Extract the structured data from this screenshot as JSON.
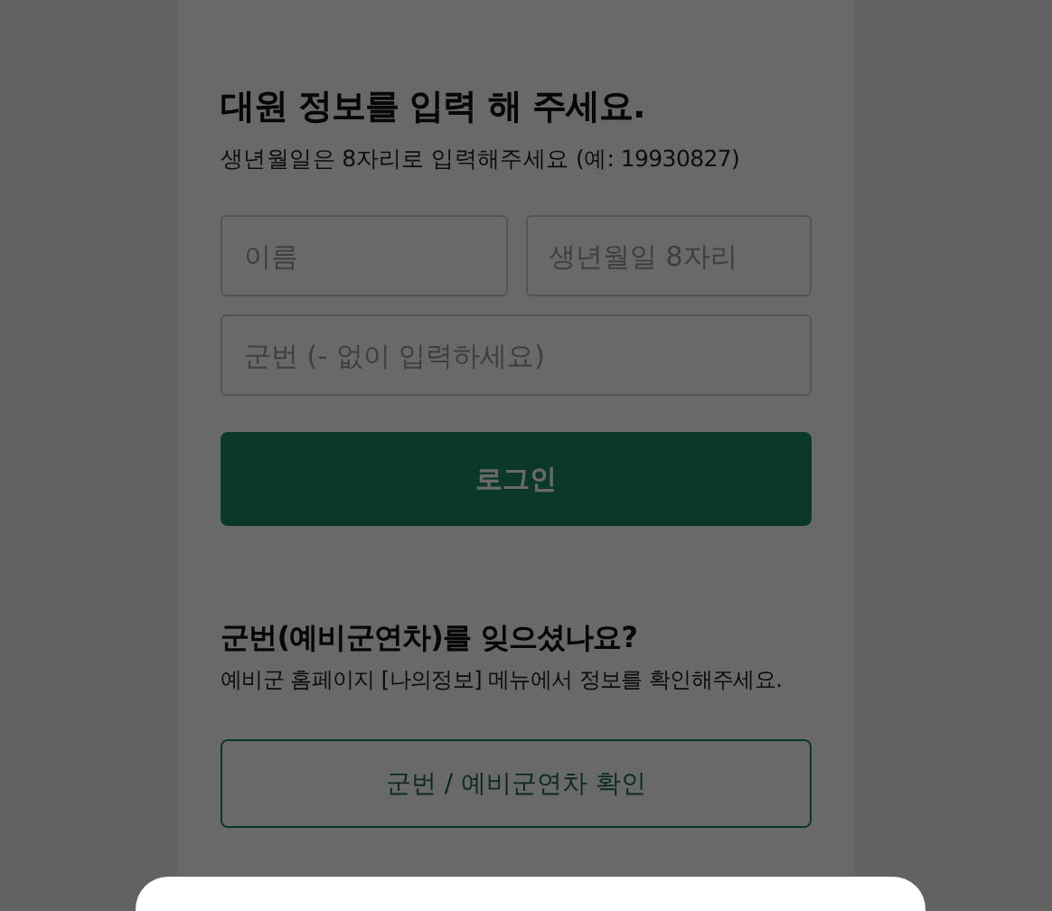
{
  "login_form": {
    "title": "대원 정보를 입력 해 주세요.",
    "hint": "생년월일은 8자리로 입력해주세요 (예: 19930827)",
    "name_field": {
      "placeholder": "이름"
    },
    "birth_field": {
      "placeholder": "생년월일 8자리"
    },
    "number_field": {
      "placeholder": "군번 (- 없이 입력하세요)"
    },
    "login_button": "로그인"
  },
  "help": {
    "title": "군번(예비군연차)를 잊으셨나요?",
    "text": "예비군 홈페이지 [나의정보] 메뉴에서 정보를 확인해주세요.",
    "button": "군번 / 예비군연차 확인"
  },
  "overlay": {
    "visible": true
  },
  "bottom_sheet": {
    "open": true
  }
}
